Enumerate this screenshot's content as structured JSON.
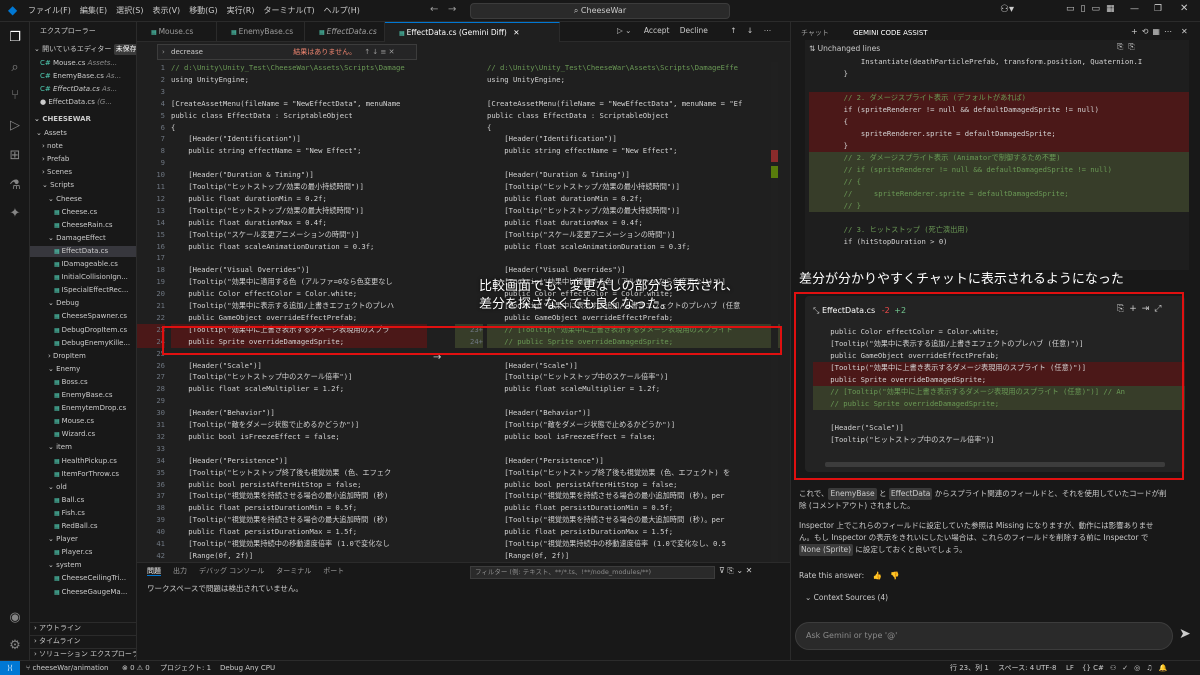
{
  "titlebar": {
    "menus": [
      "ファイル(F)",
      "編集(E)",
      "選択(S)",
      "表示(V)",
      "移動(G)",
      "実行(R)",
      "ターミナル(T)",
      "ヘルプ(H)"
    ],
    "search": "CheeseWar"
  },
  "sidebar": {
    "title": "エクスプローラー",
    "open_editors_label": "開いているエディター",
    "unsaved_badge": "未保存 (1)",
    "open_editors": [
      {
        "name": "Mouse.cs",
        "detail": "Assets..."
      },
      {
        "name": "EnemyBase.cs",
        "detail": "As..."
      },
      {
        "name": "EffectData.cs",
        "detail": "As..."
      },
      {
        "name": "EffectData.cs",
        "detail": "(G..."
      }
    ],
    "project": "CHEESEWAR",
    "tree": [
      {
        "label": "Assets",
        "depth": 1,
        "kind": "folder"
      },
      {
        "label": "note",
        "depth": 2,
        "kind": "folder"
      },
      {
        "label": "Prefab",
        "depth": 2,
        "kind": "folder"
      },
      {
        "label": "Scenes",
        "depth": 2,
        "kind": "folder"
      },
      {
        "label": "Scripts",
        "depth": 2,
        "kind": "folder"
      },
      {
        "label": "Cheese",
        "depth": 3,
        "kind": "folder"
      },
      {
        "label": "Cheese.cs",
        "depth": 4,
        "kind": "file"
      },
      {
        "label": "CheeseRain.cs",
        "depth": 4,
        "kind": "file"
      },
      {
        "label": "DamageEffect",
        "depth": 3,
        "kind": "folder"
      },
      {
        "label": "EffectData.cs",
        "depth": 4,
        "kind": "file",
        "selected": true
      },
      {
        "label": "IDamageable.cs",
        "depth": 4,
        "kind": "file"
      },
      {
        "label": "InitialCollisionIgn...",
        "depth": 4,
        "kind": "file"
      },
      {
        "label": "ISpecialEffectRec...",
        "depth": 4,
        "kind": "file"
      },
      {
        "label": "Debug",
        "depth": 3,
        "kind": "folder"
      },
      {
        "label": "CheeseSpawner.cs",
        "depth": 4,
        "kind": "file"
      },
      {
        "label": "DebugDropItem.cs",
        "depth": 4,
        "kind": "file"
      },
      {
        "label": "DebugEnemyKille...",
        "depth": 4,
        "kind": "file"
      },
      {
        "label": "DropItem",
        "depth": 3,
        "kind": "folder"
      },
      {
        "label": "Enemy",
        "depth": 3,
        "kind": "folder"
      },
      {
        "label": "Boss.cs",
        "depth": 4,
        "kind": "file"
      },
      {
        "label": "EnemyBase.cs",
        "depth": 4,
        "kind": "file"
      },
      {
        "label": "EnemytemDrop.cs",
        "depth": 4,
        "kind": "file"
      },
      {
        "label": "Mouse.cs",
        "depth": 4,
        "kind": "file"
      },
      {
        "label": "Wizard.cs",
        "depth": 4,
        "kind": "file"
      },
      {
        "label": "item",
        "depth": 3,
        "kind": "folder"
      },
      {
        "label": "HealthPickup.cs",
        "depth": 4,
        "kind": "file"
      },
      {
        "label": "ItemForThrow.cs",
        "depth": 4,
        "kind": "file"
      },
      {
        "label": "old",
        "depth": 3,
        "kind": "folder"
      },
      {
        "label": "Ball.cs",
        "depth": 4,
        "kind": "file"
      },
      {
        "label": "Fish.cs",
        "depth": 4,
        "kind": "file"
      },
      {
        "label": "RedBall.cs",
        "depth": 4,
        "kind": "file"
      },
      {
        "label": "Player",
        "depth": 3,
        "kind": "folder"
      },
      {
        "label": "Player.cs",
        "depth": 4,
        "kind": "file"
      },
      {
        "label": "system",
        "depth": 3,
        "kind": "folder"
      },
      {
        "label": "CheeseCeilingTri...",
        "depth": 4,
        "kind": "file"
      },
      {
        "label": "CheeseGaugeMa...",
        "depth": 4,
        "kind": "file"
      }
    ],
    "footer": [
      "アウトライン",
      "タイムライン",
      "ソリューション エクスプローラー"
    ]
  },
  "editor": {
    "tabs": [
      {
        "label": "Mouse.cs",
        "active": false
      },
      {
        "label": "EnemyBase.cs",
        "active": false
      },
      {
        "label": "EffectData.cs",
        "active": false
      },
      {
        "label": "EffectData.cs (Gemini Diff)",
        "active": true
      }
    ],
    "accept": "Accept",
    "decline": "Decline",
    "find_value": "decrease",
    "find_result": "結果はありません。",
    "left_lines": [
      [
        "// d:\\Unity\\Unity_Test\\CheeseWar\\Assets\\Scripts\\Damage",
        "cm",
        ""
      ],
      [
        "using UnityEngine;",
        "pl",
        ""
      ],
      [
        "",
        "pl",
        ""
      ],
      [
        "[CreateAssetMenu(fileName = \"NewEffectData\", menuName",
        "pl",
        ""
      ],
      [
        "public class EffectData : ScriptableObject",
        "pl",
        ""
      ],
      [
        "{",
        "pl",
        ""
      ],
      [
        "    [Header(\"Identification\")]",
        "pl",
        ""
      ],
      [
        "    public string effectName = \"New Effect\";",
        "pl",
        ""
      ],
      [
        "",
        "pl",
        ""
      ],
      [
        "    [Header(\"Duration & Timing\")]",
        "pl",
        ""
      ],
      [
        "    [Tooltip(\"ヒットストップ/効果の最小持続時間\")]",
        "pl",
        ""
      ],
      [
        "    public float durationMin = 0.2f;",
        "pl",
        ""
      ],
      [
        "    [Tooltip(\"ヒットストップ/効果の最大持続時間\")]",
        "pl",
        ""
      ],
      [
        "    public float durationMax = 0.4f;",
        "pl",
        ""
      ],
      [
        "    [Tooltip(\"スケール変更アニメーションの時間\")]",
        "pl",
        ""
      ],
      [
        "    public float scaleAnimationDuration = 0.3f;",
        "pl",
        ""
      ],
      [
        "",
        "pl",
        ""
      ],
      [
        "    [Header(\"Visual Overrides\")]",
        "pl",
        ""
      ],
      [
        "    [Tooltip(\"効果中に適用する色 (アルファ=0なら色変更なし",
        "pl",
        ""
      ],
      [
        "    public Color effectColor = Color.white;",
        "pl",
        ""
      ],
      [
        "    [Tooltip(\"効果中に表示する追加/上書きエフェクトのプレハ",
        "pl",
        ""
      ],
      [
        "    public GameObject overrideEffectPrefab;",
        "pl",
        ""
      ],
      [
        "    [Tooltip(\"効果中に上書き表示するダメージ表現用のスプラ",
        "pl",
        "del"
      ],
      [
        "    public Sprite overrideDamagedSprite;",
        "pl",
        "del"
      ],
      [
        "",
        "pl",
        ""
      ],
      [
        "    [Header(\"Scale\")]",
        "pl",
        ""
      ],
      [
        "    [Tooltip(\"ヒットストップ中のスケール倍率\")]",
        "pl",
        ""
      ],
      [
        "    public float scaleMultiplier = 1.2f;",
        "pl",
        ""
      ],
      [
        "",
        "pl",
        ""
      ],
      [
        "    [Header(\"Behavior\")]",
        "pl",
        ""
      ],
      [
        "    [Tooltip(\"敵をダメージ状態で止めるかどうか\")]",
        "pl",
        ""
      ],
      [
        "    public bool isFreezeEffect = false;",
        "pl",
        ""
      ],
      [
        "",
        "pl",
        ""
      ],
      [
        "    [Header(\"Persistence\")]",
        "pl",
        ""
      ],
      [
        "    [Tooltip(\"ヒットストップ終了後も視覚効果 (色、エフェク",
        "pl",
        ""
      ],
      [
        "    public bool persistAfterHitStop = false;",
        "pl",
        ""
      ],
      [
        "    [Tooltip(\"視覚効果を持続させる場合の最小追加時間 (秒)",
        "pl",
        ""
      ],
      [
        "    public float persistDurationMin = 0.5f;",
        "pl",
        ""
      ],
      [
        "    [Tooltip(\"視覚効果を持続させる場合の最大追加時間 (秒)",
        "pl",
        ""
      ],
      [
        "    public float persistDurationMax = 1.5f;",
        "pl",
        ""
      ],
      [
        "    [Tooltip(\"視覚効果持続中の移動速度倍率 (1.0で変化なし",
        "pl",
        ""
      ],
      [
        "    [Range(0f, 2f)]",
        "pl",
        ""
      ]
    ],
    "left_numbers": [
      "1",
      "2",
      "3",
      "4",
      "5",
      "6",
      "7",
      "8",
      "9",
      "10",
      "11",
      "12",
      "13",
      "14",
      "15",
      "16",
      "17",
      "18",
      "19",
      "20",
      "21",
      "22",
      "23",
      "24",
      "25",
      "26",
      "27",
      "28",
      "29",
      "30",
      "31",
      "32",
      "33",
      "34",
      "35",
      "36",
      "37",
      "38",
      "39",
      "40",
      "41",
      "42"
    ],
    "right_lines": [
      [
        "// d:\\Unity\\Unity_Test\\CheeseWar\\Assets\\Scripts\\DamageEffe",
        "cm",
        ""
      ],
      [
        "using UnityEngine;",
        "pl",
        ""
      ],
      [
        "",
        "pl",
        ""
      ],
      [
        "[CreateAssetMenu(fileName = \"NewEffectData\", menuName = \"Ef",
        "pl",
        ""
      ],
      [
        "public class EffectData : ScriptableObject",
        "pl",
        ""
      ],
      [
        "{",
        "pl",
        ""
      ],
      [
        "    [Header(\"Identification\")]",
        "pl",
        ""
      ],
      [
        "    public string effectName = \"New Effect\";",
        "pl",
        ""
      ],
      [
        "",
        "pl",
        ""
      ],
      [
        "    [Header(\"Duration & Timing\")]",
        "pl",
        ""
      ],
      [
        "    [Tooltip(\"ヒットストップ/効果の最小持続時間\")]",
        "pl",
        ""
      ],
      [
        "    public float durationMin = 0.2f;",
        "pl",
        ""
      ],
      [
        "    [Tooltip(\"ヒットストップ/効果の最大持続時間\")]",
        "pl",
        ""
      ],
      [
        "    public float durationMax = 0.4f;",
        "pl",
        ""
      ],
      [
        "    [Tooltip(\"スケール変更アニメーションの時間\")]",
        "pl",
        ""
      ],
      [
        "    public float scaleAnimationDuration = 0.3f;",
        "pl",
        ""
      ],
      [
        "",
        "pl",
        ""
      ],
      [
        "    [Header(\"Visual Overrides\")]",
        "pl",
        ""
      ],
      [
        "    [Tooltip(\"効果中に適用する色 (アルファ=0なら色変更なし)\")]",
        "pl",
        ""
      ],
      [
        "    public Color effectColor = Color.white;",
        "pl",
        ""
      ],
      [
        "    [Tooltip(\"効果中に表示する追加/上書きエフェクトのプレハブ (任意",
        "pl",
        ""
      ],
      [
        "    public GameObject overrideEffectPrefab;",
        "pl",
        ""
      ],
      [
        "    // [Tooltip(\"効果中に上書き表示するダメージ表現用のスプライト",
        "cm",
        "add"
      ],
      [
        "    // public Sprite overrideDamagedSprite;",
        "cm",
        "add"
      ],
      [
        "",
        "pl",
        ""
      ],
      [
        "    [Header(\"Scale\")]",
        "pl",
        ""
      ],
      [
        "    [Tooltip(\"ヒットストップ中のスケール倍率\")]",
        "pl",
        ""
      ],
      [
        "    public float scaleMultiplier = 1.2f;",
        "pl",
        ""
      ],
      [
        "",
        "pl",
        ""
      ],
      [
        "    [Header(\"Behavior\")]",
        "pl",
        ""
      ],
      [
        "    [Tooltip(\"敵をダメージ状態で止めるかどうか\")]",
        "pl",
        ""
      ],
      [
        "    public bool isFreezeEffect = false;",
        "pl",
        ""
      ],
      [
        "",
        "pl",
        ""
      ],
      [
        "    [Header(\"Persistence\")]",
        "pl",
        ""
      ],
      [
        "    [Tooltip(\"ヒットストップ終了後も視覚効果 (色、エフェクト) を",
        "pl",
        ""
      ],
      [
        "    public bool persistAfterHitStop = false;",
        "pl",
        ""
      ],
      [
        "    [Tooltip(\"視覚効果を持続させる場合の最小追加時間 (秒)。per",
        "pl",
        ""
      ],
      [
        "    public float persistDurationMin = 0.5f;",
        "pl",
        ""
      ],
      [
        "    [Tooltip(\"視覚効果を持続させる場合の最大追加時間 (秒)。per",
        "pl",
        ""
      ],
      [
        "    public float persistDurationMax = 1.5f;",
        "pl",
        ""
      ],
      [
        "    [Tooltip(\"視覚効果持続中の移動速度倍率 (1.0で変化なし、0.5",
        "pl",
        ""
      ],
      [
        "    [Range(0f, 2f)]",
        "pl",
        ""
      ]
    ],
    "right_numbers": [
      "",
      "",
      "",
      "",
      "",
      "",
      "",
      "",
      "",
      "",
      "",
      "",
      "",
      "",
      "",
      "",
      "",
      "",
      "",
      "",
      "",
      "",
      "23+",
      "24+",
      "",
      "",
      "",
      "",
      "",
      "",
      "",
      "",
      "",
      "",
      "",
      "",
      "",
      "",
      "",
      "",
      "",
      ""
    ],
    "overlay_note": "比較画面でも、変更なしの部分も表示され、\n差分を探さなくても良くなった。"
  },
  "panel": {
    "tabs": [
      "問題",
      "出力",
      "デバッグ コンソール",
      "ターミナル",
      "ポート"
    ],
    "message": "ワークスペースで問題は検出されていません。",
    "filter_placeholder": "フィルター (例: テキスト、**/*.ts、!**/node_modules/**)"
  },
  "chat": {
    "tabs": [
      "チャット",
      "GEMINI CODE ASSIST"
    ],
    "unchanged": "Unchanged lines",
    "code_lines": [
      [
        "            Instantiate(deathParticlePrefab, transform.position, Quaternion.I",
        "pl",
        ""
      ],
      [
        "        }",
        "pl",
        ""
      ],
      [
        "",
        "pl",
        ""
      ],
      [
        "        // 2. ダメージスプライト表示 (デフォルトがあれば)",
        "cm",
        "del"
      ],
      [
        "        if (spriteRenderer != null && defaultDamagedSprite != null)",
        "pl",
        "del"
      ],
      [
        "        {",
        "pl",
        "del"
      ],
      [
        "            spriteRenderer.sprite = defaultDamagedSprite;",
        "pl",
        "del"
      ],
      [
        "        }",
        "pl",
        "del"
      ],
      [
        "        // 2. ダメージスプライト表示 (Animatorで制御するため不要)",
        "cm",
        "add"
      ],
      [
        "        // if (spriteRenderer != null && defaultDamagedSprite != null)",
        "cm",
        "add"
      ],
      [
        "        // {",
        "cm",
        "add"
      ],
      [
        "        //     spriteRenderer.sprite = defaultDamagedSprite;",
        "cm",
        "add"
      ],
      [
        "        // }",
        "cm",
        "add"
      ],
      [
        "",
        "pl",
        ""
      ],
      [
        "        // 3. ヒットストップ (死亡演出用)",
        "cm",
        ""
      ],
      [
        "        if (hitStopDuration > 0)",
        "pl",
        ""
      ]
    ],
    "annotation": "差分が分かりやすくチャットに表示されるようになった",
    "diff_file": "EffectData.cs",
    "diff_removed": "-2",
    "diff_added": "+2",
    "diff_lines": [
      [
        "    public Color effectColor = Color.white;",
        "pl",
        ""
      ],
      [
        "    [Tooltip(\"効果中に表示する追加/上書きエフェクトのプレハブ (任意)\")]",
        "pl",
        ""
      ],
      [
        "    public GameObject overrideEffectPrefab;",
        "pl",
        ""
      ],
      [
        "    [Tooltip(\"効果中に上書き表示するダメージ表現用のスプライト (任意)\")]",
        "pl",
        "del"
      ],
      [
        "    public Sprite overrideDamagedSprite;",
        "pl",
        "del"
      ],
      [
        "    // [Tooltip(\"効果中に上書き表示するダメージ表現用のスプライト (任意)\")] // An",
        "cm",
        "add"
      ],
      [
        "    // public Sprite overrideDamagedSprite;",
        "cm",
        "add"
      ],
      [
        "",
        "pl",
        ""
      ],
      [
        "    [Header(\"Scale\")]",
        "pl",
        ""
      ],
      [
        "    [Tooltip(\"ヒットストップ中のスケール倍率\")]",
        "pl",
        ""
      ]
    ],
    "resp_1a": "これで、",
    "resp_chip1": "EnemyBase",
    "resp_1b": " と ",
    "resp_chip2": "EffectData",
    "resp_1c": " からスプライト関連のフィールドと、それを使用していたコードが削",
    "resp_1d": "除 (コメントアウト) されました。",
    "resp_2a": "Inspector 上でこれらのフィールドに設定していた参照は Missing になりますが、動作には影響ありませ",
    "resp_2b": "ん。もし Inspector の表示をきれいにしたい場合は、これらのフィールドを削除する前に Inspector で",
    "resp_chip3": "None (Sprite)",
    "resp_2c": " に設定しておくと良いでしょう。",
    "rate": "Rate this answer:",
    "context_sources": "Context Sources (4)",
    "input_placeholder": "Ask Gemini or type '@'"
  },
  "statusbar": {
    "branch": "cheeseWar/animation",
    "problems": "⊗ 0  ⚠ 0",
    "project": "プロジェクト: 1",
    "debug": "Debug Any CPU",
    "position": "行 23、列 1",
    "spaces": "スペース: 4",
    "encoding": "UTF-8",
    "eol": "LF",
    "lang": "{} C#"
  },
  "colors": {
    "accent": "#0078d4",
    "highlight_box": "#e01010",
    "deleted": "#4b1818",
    "added": "#373d29"
  }
}
